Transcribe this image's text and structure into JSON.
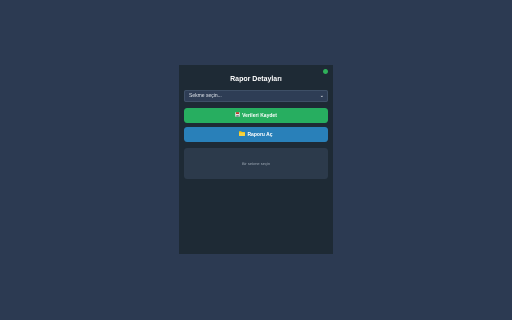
{
  "panel": {
    "title": "Rapor Detayları",
    "status_color": "#2fb15a"
  },
  "select": {
    "value": "Sekme seçin...",
    "icon": "chevron-down-icon"
  },
  "buttons": {
    "save_label": "Verileri Kaydet",
    "save_icon": "save-icon",
    "save_color": "#27ae60",
    "open_label": "Raporu Aç",
    "open_icon": "folder-icon",
    "open_color": "#2980b9"
  },
  "result": {
    "message": "Bir sekme seçin"
  }
}
